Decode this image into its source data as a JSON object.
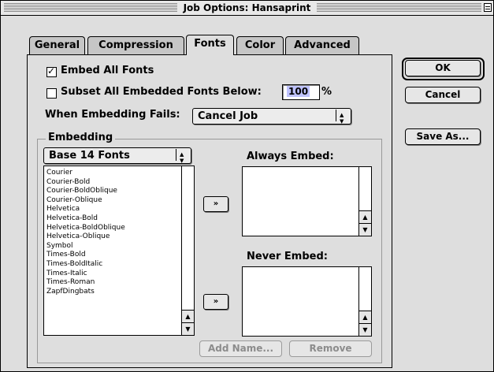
{
  "window": {
    "title": "Job Options: Hansaprint"
  },
  "tabs": [
    {
      "label": "General",
      "active": false
    },
    {
      "label": "Compression",
      "active": false
    },
    {
      "label": "Fonts",
      "active": true
    },
    {
      "label": "Color",
      "active": false
    },
    {
      "label": "Advanced",
      "active": false
    }
  ],
  "fonts": {
    "embed_all_label": "Embed All Fonts",
    "embed_all_checked": true,
    "subset_label": "Subset All Embedded Fonts Below:",
    "subset_checked": false,
    "subset_value": "100",
    "subset_unit": "%",
    "when_fails_label": "When Embedding Fails:",
    "when_fails_value": "Cancel Job"
  },
  "embedding": {
    "group_title": "Embedding",
    "source_popup": "Base 14 Fonts",
    "font_list": [
      "Courier",
      "Courier-Bold",
      "Courier-BoldOblique",
      "Courier-Oblique",
      "Helvetica",
      "Helvetica-Bold",
      "Helvetica-BoldOblique",
      "Helvetica-Oblique",
      "Symbol",
      "Times-Bold",
      "Times-BoldItalic",
      "Times-Italic",
      "Times-Roman",
      "ZapfDingbats"
    ],
    "add_arrow_label": "»",
    "always_embed_label": "Always Embed:",
    "never_embed_label": "Never Embed:",
    "add_name_label": "Add Name...",
    "remove_label": "Remove"
  },
  "buttons": {
    "ok": "OK",
    "cancel": "Cancel",
    "save_as": "Save As..."
  },
  "colors": {
    "window_bg": "#dedede",
    "disabled_text": "#8c8c8c"
  }
}
